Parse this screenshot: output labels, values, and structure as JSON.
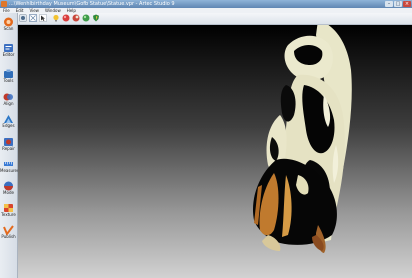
{
  "window": {
    "title": "...\\Wenhlbirthday Museum\\Gofb Statue\\Statue.vpr - Artec Studio 9",
    "controls": {
      "minimize": "–",
      "maximize": "□",
      "close": "×"
    }
  },
  "menu": {
    "items": [
      "File",
      "Edit",
      "View",
      "Window",
      "Help"
    ]
  },
  "toolbar": {
    "buttons": [
      {
        "icon": "camera-icon"
      },
      {
        "icon": "fit-view-icon"
      },
      {
        "icon": "pointer-icon"
      },
      {
        "icon": "light-icon"
      },
      {
        "icon": "color-sphere-icon"
      },
      {
        "icon": "texture-sphere-icon"
      },
      {
        "icon": "green-sphere-icon"
      },
      {
        "icon": "shield-icon"
      }
    ]
  },
  "sidebar": {
    "items": [
      {
        "label": "Scan",
        "icon": "scan-icon",
        "color": "#e36a1e"
      },
      {
        "label": "Editor",
        "icon": "editor-icon",
        "color": "#3b6fc1"
      },
      {
        "label": "Tools",
        "icon": "tools-icon",
        "color": "#2f6db8"
      },
      {
        "label": "Align",
        "icon": "align-icon",
        "color": "#c0392b"
      },
      {
        "label": "Edges",
        "icon": "edges-icon",
        "color": "#2c77c6"
      },
      {
        "label": "Repair",
        "icon": "repair-icon",
        "color": "#c0392b"
      },
      {
        "label": "Measures",
        "icon": "measures-icon",
        "color": "#3a7bd5"
      },
      {
        "label": "Mode",
        "icon": "mode-icon",
        "color": "#c0392b"
      },
      {
        "label": "Texture",
        "icon": "texture-icon",
        "color": "#d8452e"
      },
      {
        "label": "Publish",
        "icon": "publish-icon",
        "color": "#e36a1e"
      }
    ]
  },
  "viewport": {
    "model": "statue-3d-scan",
    "colors": {
      "bg_top": "#000000",
      "bg_bottom": "#d2d2d2",
      "mesh": "#e8e6c8",
      "texture": "#c07a2e"
    }
  }
}
